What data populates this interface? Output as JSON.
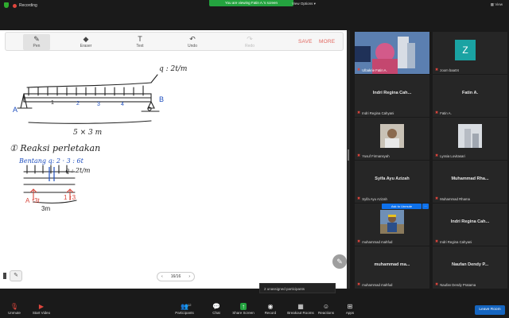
{
  "top": {
    "recording_label": "Recording",
    "viewing_banner": "You are viewing Fatin A.'s screen",
    "view_options": "View Options ▾",
    "view_label": "View"
  },
  "whiteboard_toolbar": {
    "pen": "Pen",
    "eraser": "Eraser",
    "text": "Text",
    "undo": "Undo",
    "redo": "Redo",
    "save": "SAVE",
    "more": "MORE"
  },
  "whiteboard": {
    "load_label": "q : 2t/m",
    "support_a": "A",
    "support_b": "B",
    "span_marks": [
      "1",
      "2",
      "3",
      "4"
    ],
    "dimension": "5 × 3 m",
    "section_title": "① Reaksi perletakan",
    "bentang_line": "Bentang q: 2 · 3 : 6t",
    "load_small": "q : 2t/m",
    "reaction_a": "A ↑3t",
    "reaction_b": "1 ↑3",
    "small_dim": "3m",
    "accent_red": "#d9463b",
    "accent_blue": "#1f4fbf"
  },
  "pager": {
    "prev": "‹",
    "label": "16/16",
    "next": "›"
  },
  "unassigned": "2 unassigned participants",
  "participants": [
    {
      "name": "",
      "label": "Ulbakrie Fatin A.",
      "video": true,
      "highlight": true
    },
    {
      "name": "",
      "label": "zoom baa04",
      "avatar": "Z"
    },
    {
      "name": "Indri Regina Cah...",
      "label": "Indri Regina Cahyani"
    },
    {
      "name": "Fatin A.",
      "label": "Fatin A."
    },
    {
      "name": "",
      "label": "Yusuf Firmansyah",
      "video": true
    },
    {
      "name": "",
      "label": "Lyssia Lovitasari",
      "video": true
    },
    {
      "name": "Syifa Ayu Azizah",
      "label": "Syifa Ayu Azizah"
    },
    {
      "name": "Muhammad Rha...",
      "label": "Muhammad Rhama"
    },
    {
      "name": "",
      "label": "muhammad mahfud",
      "video": true
    },
    {
      "name": "Indri Regina Cah...",
      "label": "Indri Regina Cahyani"
    },
    {
      "name": "muhammad ma...",
      "label": "muhammad mahfud"
    },
    {
      "name": "Naufan Dendy P...",
      "label": "Naufan Dendy Pratama"
    }
  ],
  "ask_to_unmute": "Ask to Unmute",
  "ask_more": "...",
  "bottom": {
    "unmute": "Unmute",
    "start_video": "Start Video",
    "participants": "Participants",
    "participants_count": "12",
    "chat": "Chat",
    "share_screen": "Share Screen",
    "record": "Record",
    "breakout_rooms": "Breakout Rooms",
    "reactions": "Reactions",
    "apps": "Apps",
    "leave": "Leave Room"
  },
  "colors": {
    "green": "#24a33f",
    "blue": "#0e71eb",
    "red": "#e0463d",
    "highlight": "#e6c33a"
  }
}
